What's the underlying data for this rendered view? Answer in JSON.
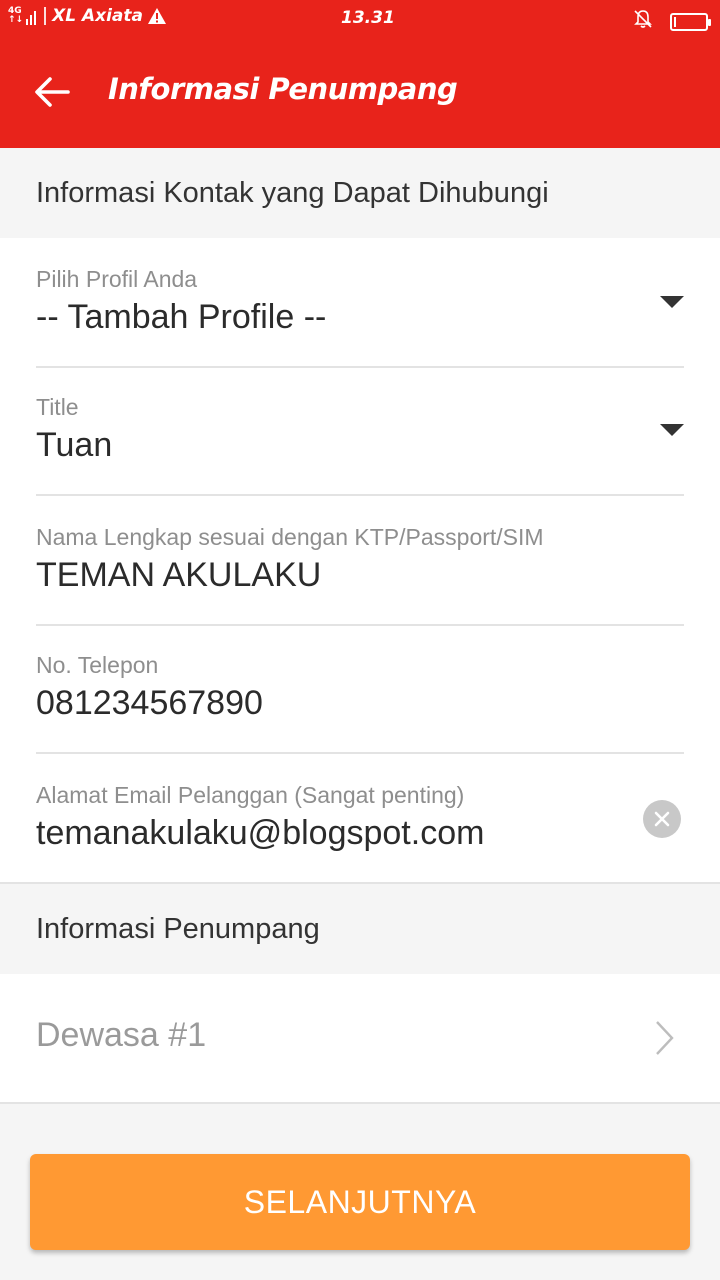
{
  "status_bar": {
    "network_top": "4G",
    "network_bottom": "↑↓",
    "carrier": "XL Axiata",
    "time": "13.31",
    "icons": [
      "signal-icon",
      "warning-icon",
      "silent-bell-icon",
      "battery-icon"
    ],
    "battery_level": 0.05
  },
  "app_bar": {
    "title": "Informasi Penumpang",
    "back_icon": "arrow-left-icon",
    "color": "#e8231b"
  },
  "contact_section": {
    "header": "Informasi Kontak yang Dapat Dihubungi",
    "profile": {
      "label": "Pilih Profil Anda",
      "value": "-- Tambah Profile --"
    },
    "title": {
      "label": "Title",
      "value": "Tuan"
    },
    "full_name": {
      "label": "Nama Lengkap sesuai dengan KTP/Passport/SIM",
      "value": "TEMAN AKULAKU"
    },
    "phone": {
      "label": "No. Telepon",
      "value": "081234567890"
    },
    "email": {
      "label": "Alamat Email Pelanggan (Sangat penting)",
      "value": "temanakulaku@blogspot.com"
    }
  },
  "passenger_section": {
    "header": "Informasi Penumpang",
    "items": [
      {
        "label": "Dewasa #1"
      }
    ]
  },
  "next_button": {
    "label": "SELANJUTNYA",
    "color": "#ff9933"
  }
}
